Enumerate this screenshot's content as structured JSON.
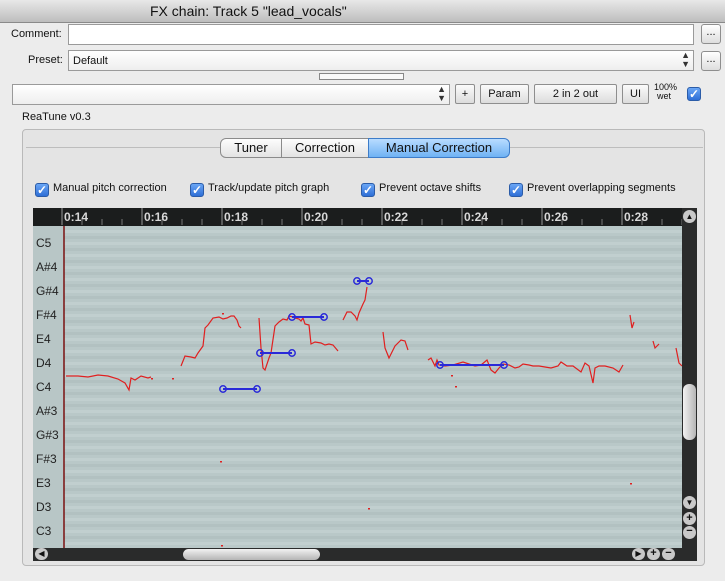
{
  "window": {
    "title": "FX chain: Track 5 \"lead_vocals\""
  },
  "comment": {
    "label": "Comment:",
    "value": "",
    "more_label": "..."
  },
  "preset": {
    "label": "Preset:",
    "value": "Default",
    "more_label": "..."
  },
  "plugin_select": {
    "value": ""
  },
  "toolbar": {
    "plus_label": "+",
    "param_label": "Param",
    "io_label": "2 in 2 out",
    "ui_label": "UI",
    "wet_pct": "100%",
    "wet_label": "wet",
    "wet_checked": true
  },
  "plugin_name": "ReaTune v0.3",
  "tabs": [
    {
      "label": "Tuner",
      "active": false
    },
    {
      "label": "Correction",
      "active": false
    },
    {
      "label": "Manual Correction",
      "active": true
    }
  ],
  "options": [
    {
      "label": "Manual pitch correction",
      "checked": true
    },
    {
      "label": "Track/update pitch graph",
      "checked": true
    },
    {
      "label": "Prevent octave shifts",
      "checked": true
    },
    {
      "label": "Prevent overlapping segments",
      "checked": true
    }
  ],
  "timeline": [
    "0:14",
    "0:16",
    "0:18",
    "0:20",
    "0:22",
    "0:24",
    "0:26",
    "0:28"
  ],
  "notes": [
    "C5",
    "A#4",
    "G#4",
    "F#4",
    "E4",
    "D4",
    "C4",
    "A#3",
    "G#3",
    "F#3",
    "E3",
    "D3",
    "C3"
  ],
  "colors": {
    "pitch_curve": "#e02020",
    "segment": "#2a2ad8",
    "graph_bg": "#b9c8c8",
    "active_tab": "#6fb2f4"
  },
  "scroll_icons": [
    "chevron-up-icon",
    "chevron-down-icon",
    "zoom-in-icon",
    "zoom-out-icon",
    "chevron-left-icon",
    "chevron-right-icon"
  ]
}
